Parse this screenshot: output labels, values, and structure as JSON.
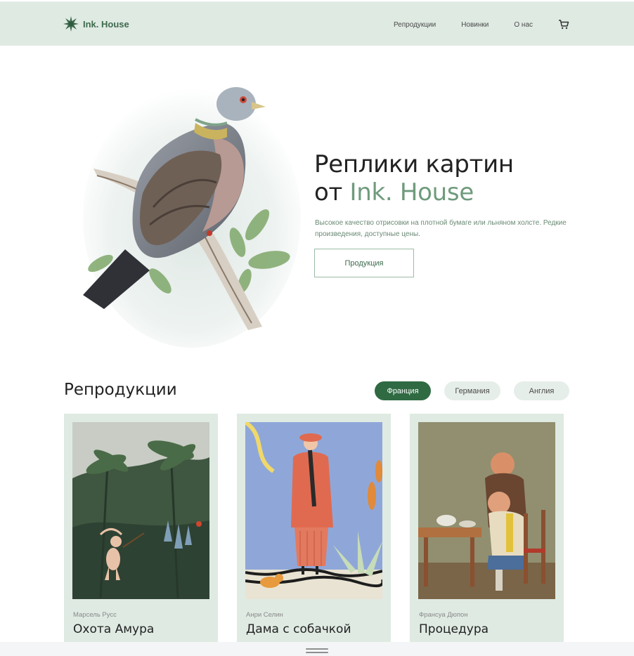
{
  "header": {
    "logo_text": "Ink. House",
    "nav": [
      "Репродукции",
      "Новинки",
      "О нас"
    ],
    "cart_icon": "cart-icon"
  },
  "hero": {
    "title_line1": "Реплики картин",
    "title_prefix": "от",
    "title_accent": "Ink. House",
    "description": "Высокое качество отрисовки на плотной бумаге или льняном холсте. Редкие произведения, доступные цены.",
    "button_label": "Продукция"
  },
  "section": {
    "title": "Репродукции",
    "filters": [
      {
        "label": "Франция",
        "active": true
      },
      {
        "label": "Германия",
        "active": false
      },
      {
        "label": "Англия",
        "active": false
      }
    ]
  },
  "cards": [
    {
      "artist": "Марсель Русс",
      "title": "Охота Амура"
    },
    {
      "artist": "Анри Селин",
      "title": "Дама с собачкой"
    },
    {
      "artist": "Франсуа Дюпон",
      "title": "Процедура"
    }
  ],
  "colors": {
    "header_bg": "#dfeae3",
    "accent": "#6f9b7c",
    "active_chip": "#2f6a43",
    "card_bg": "#dfeae3"
  }
}
